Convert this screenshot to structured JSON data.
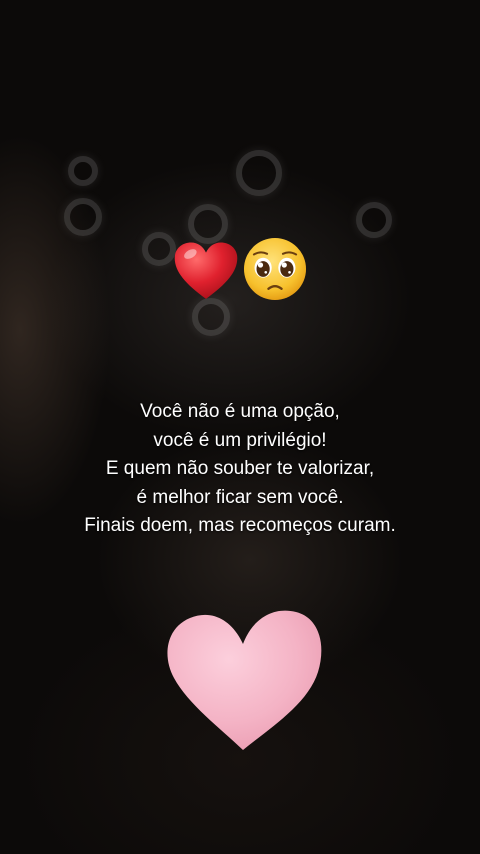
{
  "emojis": {
    "first": "red-heart-icon",
    "second": "pleading-face-icon"
  },
  "quote": {
    "line1": "Você não é uma opção,",
    "line2": "você é um privilégio!",
    "line3": "E quem não souber te valorizar,",
    "line4": "é melhor ficar sem você.",
    "line5": "Finais doem, mas recomeços curam."
  },
  "colors": {
    "background": "#0c0a09",
    "text": "#ffffff",
    "red_heart": "#e0212e",
    "pink_heart": "#f4b3c5",
    "face": "#f7c12d"
  },
  "decor": {
    "bottom_icon": "pink-heart-icon"
  }
}
